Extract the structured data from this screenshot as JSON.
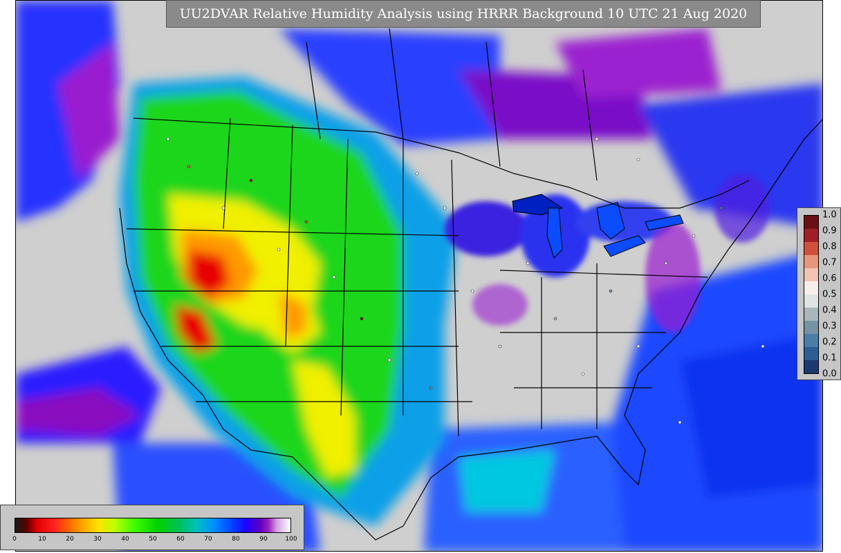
{
  "title": "UU2DVAR Relative Humidity Analysis using HRRR Background 10 UTC 21 Aug 2020",
  "rh_colorbar": {
    "ticks": [
      "0",
      "10",
      "20",
      "30",
      "40",
      "50",
      "60",
      "70",
      "80",
      "90",
      "100"
    ],
    "stops": [
      {
        "v": 0,
        "c": "#1a1a1a"
      },
      {
        "v": 4,
        "c": "#5a0000"
      },
      {
        "v": 8,
        "c": "#e00000"
      },
      {
        "v": 14,
        "c": "#ff2020"
      },
      {
        "v": 19,
        "c": "#ff6000"
      },
      {
        "v": 24,
        "c": "#ffa000"
      },
      {
        "v": 30,
        "c": "#ffe000"
      },
      {
        "v": 36,
        "c": "#c0ff00"
      },
      {
        "v": 43,
        "c": "#40ff00"
      },
      {
        "v": 52,
        "c": "#00d000"
      },
      {
        "v": 60,
        "c": "#00c060"
      },
      {
        "v": 66,
        "c": "#00c0c0"
      },
      {
        "v": 72,
        "c": "#0090ff"
      },
      {
        "v": 79,
        "c": "#0040ff"
      },
      {
        "v": 84,
        "c": "#2000ff"
      },
      {
        "v": 89,
        "c": "#6000c0"
      },
      {
        "v": 92,
        "c": "#9a20c0"
      },
      {
        "v": 95,
        "c": "#d0a0e0"
      },
      {
        "v": 100,
        "c": "#ffffff"
      }
    ]
  },
  "obs_colorbar": {
    "ticks": [
      "1.0",
      "0.9",
      "0.8",
      "0.7",
      "0.6",
      "0.5",
      "0.4",
      "0.3",
      "0.2",
      "0.1",
      "0.0"
    ],
    "colors": [
      "#1c3a6e",
      "#2c5e93",
      "#4b7da8",
      "#7693a6",
      "#a9b7bc",
      "#dfe3e5",
      "#f6efec",
      "#f1c4b3",
      "#e7967c",
      "#d0503e",
      "#9e1f25",
      "#6a1015"
    ]
  },
  "map": {
    "dry_region_colors": {
      "green": "#1fd61f",
      "yellow": "#f0f000",
      "orange": "#ff9900",
      "red": "#e80000"
    },
    "moist_region_colors": {
      "cyan": "#00b8e8",
      "blue": "#0b3aff",
      "purple": "#8e00c8",
      "gray": "#cfcfcf"
    }
  }
}
